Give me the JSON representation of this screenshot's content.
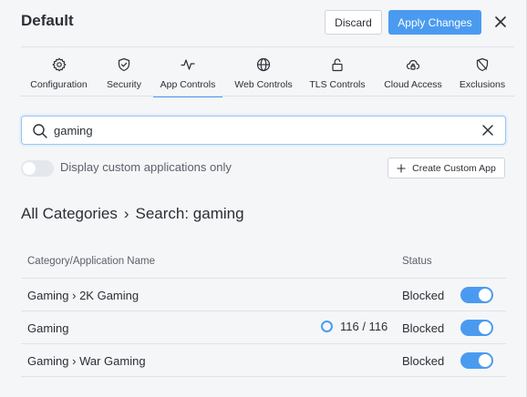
{
  "header": {
    "title": "Default",
    "discard_label": "Discard",
    "apply_label": "Apply Changes"
  },
  "tabs": [
    {
      "label": "Configuration",
      "icon": "gear-icon",
      "active": false
    },
    {
      "label": "Security",
      "icon": "shield-check-icon",
      "active": false
    },
    {
      "label": "App Controls",
      "icon": "activity-icon",
      "active": true
    },
    {
      "label": "Web Controls",
      "icon": "globe-icon",
      "active": false
    },
    {
      "label": "TLS Controls",
      "icon": "lock-icon",
      "active": false
    },
    {
      "label": "Cloud Access",
      "icon": "cloud-lock-icon",
      "active": false
    },
    {
      "label": "Exclusions",
      "icon": "shield-off-icon",
      "active": false
    }
  ],
  "search": {
    "value": "gaming",
    "placeholder": ""
  },
  "filters": {
    "custom_only_label": "Display custom applications only",
    "custom_only_enabled": false,
    "create_label": "Create Custom App"
  },
  "breadcrumb": {
    "root": "All Categories",
    "separator": "›",
    "current": "Search: gaming"
  },
  "table": {
    "col_name": "Category/Application Name",
    "col_status": "Status",
    "rows": [
      {
        "name": "Gaming › 2K Gaming",
        "count": "",
        "status": "Blocked",
        "enabled": true
      },
      {
        "name": "Gaming",
        "count": "116 / 116",
        "status": "Blocked",
        "enabled": true
      },
      {
        "name": "Gaming › War Gaming",
        "count": "",
        "status": "Blocked",
        "enabled": true
      }
    ]
  },
  "colors": {
    "accent": "#4a9bf0",
    "background": "#f5f6f8",
    "text": "#2b2f36"
  }
}
